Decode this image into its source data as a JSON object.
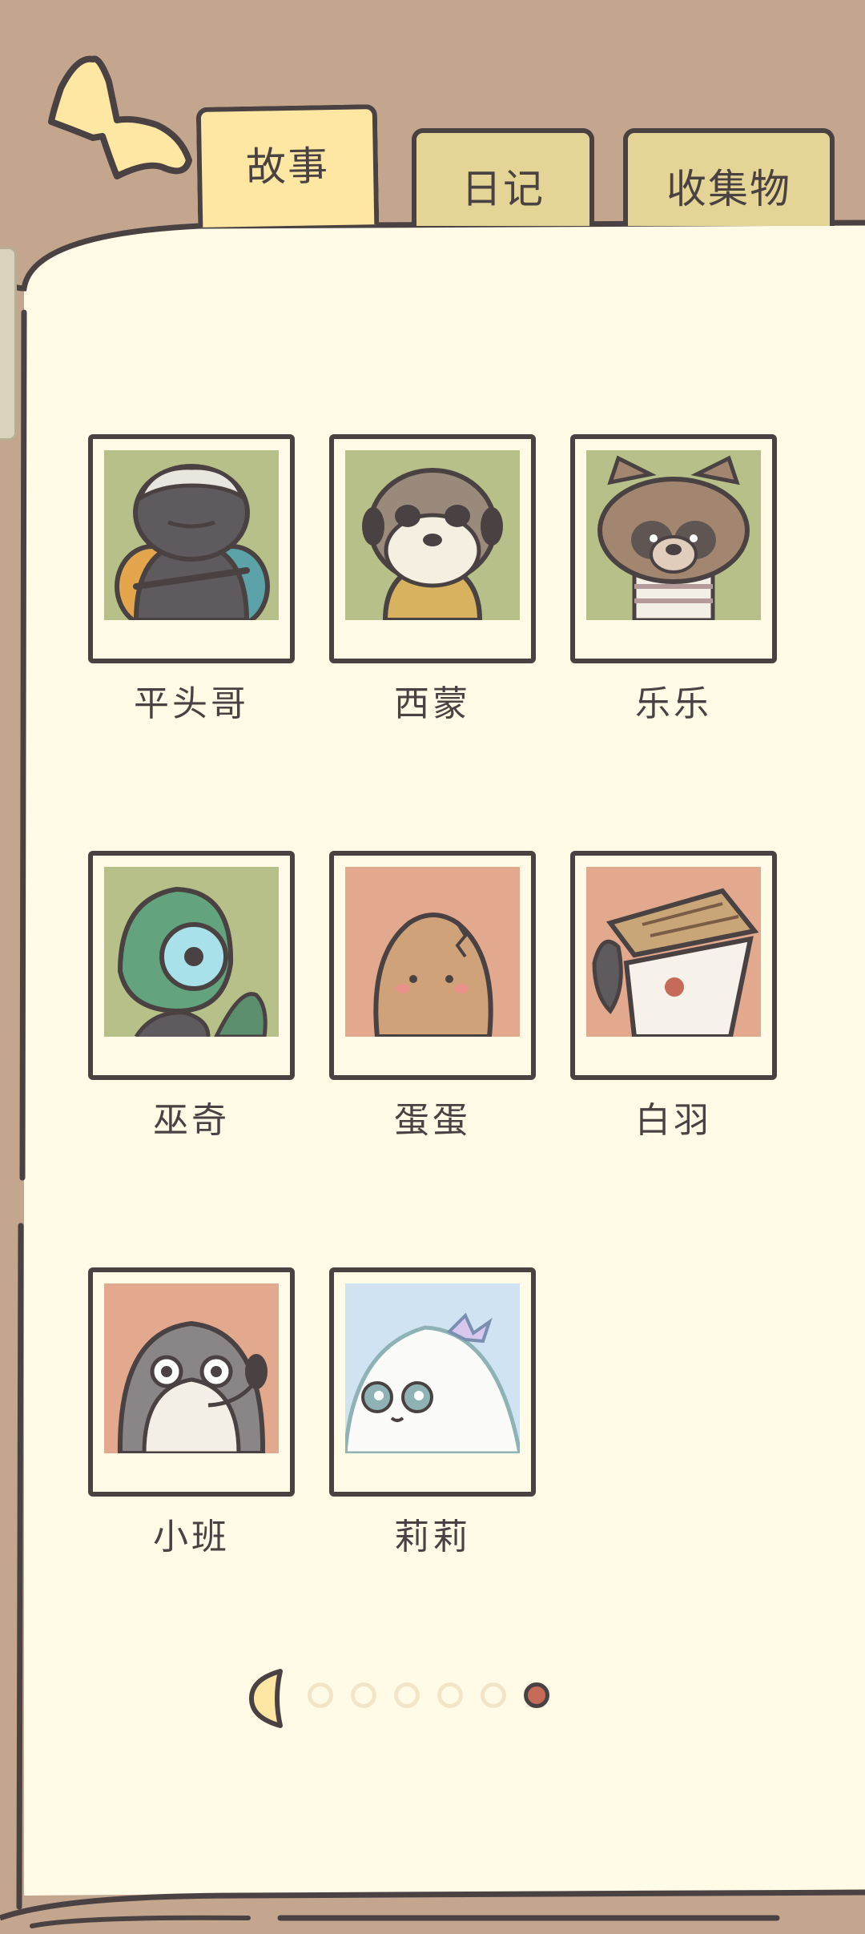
{
  "tabs": [
    {
      "label": "故事",
      "active": true
    },
    {
      "label": "日记",
      "active": false
    },
    {
      "label": "收集物",
      "active": false
    }
  ],
  "characters": [
    {
      "name": "平头哥",
      "bg": "#b7c088"
    },
    {
      "name": "西蒙",
      "bg": "#b7c088"
    },
    {
      "name": "乐乐",
      "bg": "#b7c088"
    },
    {
      "name": "巫奇",
      "bg": "#b7c088"
    },
    {
      "name": "蛋蛋",
      "bg": "#e2a98e"
    },
    {
      "name": "白羽",
      "bg": "#e2a98e"
    },
    {
      "name": "小班",
      "bg": "#e2a98e"
    },
    {
      "name": "莉莉",
      "bg": "#cfe3f3"
    }
  ],
  "pagination": {
    "pages": 6,
    "current": 6
  },
  "colors": {
    "page": "#fffbe6",
    "outline": "#4a4242",
    "active_tab": "#fde7a3",
    "inactive_tab": "#e4d495",
    "frame": "#c4a58d",
    "active_dot": "#c56b57"
  },
  "icons": {
    "back": "back-arrow-icon",
    "prev": "prev-page-icon"
  }
}
